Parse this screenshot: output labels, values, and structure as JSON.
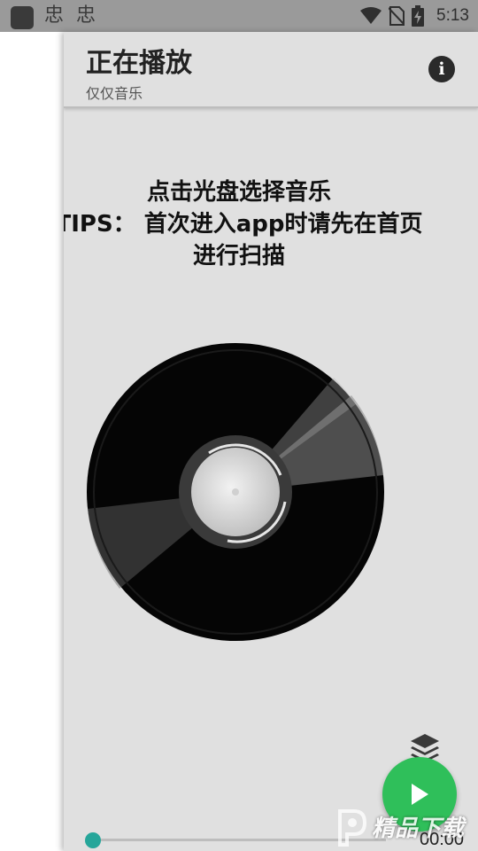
{
  "status_bar": {
    "notif_icons": [
      "忠",
      "忠"
    ],
    "time": "5:13",
    "icons": [
      "wifi-icon",
      "no-sim-icon",
      "battery-charging-icon"
    ]
  },
  "toolbar": {
    "title": "正在播放",
    "subtitle": "仅仅音乐",
    "info_icon": "info-icon"
  },
  "hint": {
    "text": "点击光盘选择音乐\nTIPS： 首次进入app时请先在首页\n进行扫描"
  },
  "player": {
    "disc": "vinyl-disc",
    "progress": 0.0,
    "time": "00:00",
    "play_icon": "play-icon",
    "playlist_icon": "layers-icon",
    "accent_color": "#2fbf5a",
    "seek_color": "#26a69a"
  },
  "watermark": {
    "text": "精品下载"
  }
}
